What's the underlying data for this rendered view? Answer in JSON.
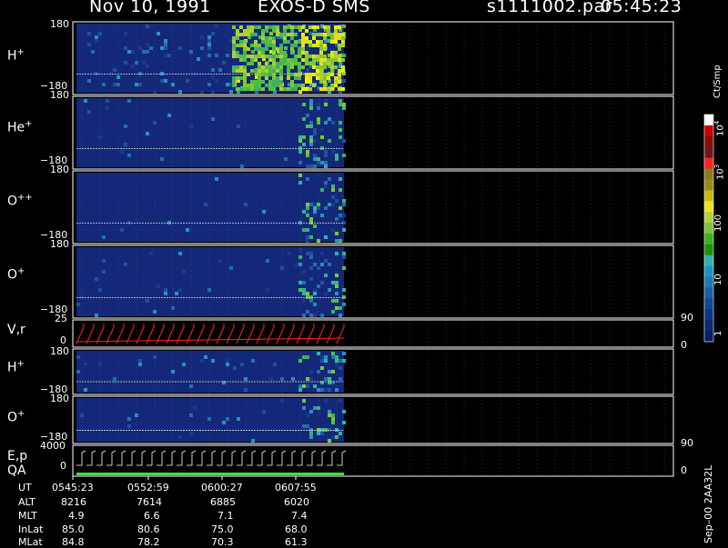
{
  "header": {
    "date": "Nov 10, 1991",
    "instrument": "EXOS-D SMS",
    "file": "s1111002.par",
    "time": "05:45:23"
  },
  "panels": [
    {
      "label_main": "H",
      "label_sup": "+",
      "y_top": "180",
      "y_bot": "−180"
    },
    {
      "label_main": "He",
      "label_sup": "+",
      "y_top": "180",
      "y_bot": "−180"
    },
    {
      "label_main": "O",
      "label_sup": "++",
      "y_top": "180",
      "y_bot": "−180"
    },
    {
      "label_main": "O",
      "label_sup": "+",
      "y_top": "180",
      "y_bot": "−180"
    },
    {
      "label_main": "V,r",
      "label_sup": "",
      "y_top": "25",
      "y_bot": "0",
      "right_top": "90",
      "right_bot": "0"
    },
    {
      "label_main": "H",
      "label_sup": "+",
      "y_top": "180",
      "y_bot": "−180"
    },
    {
      "label_main": "O",
      "label_sup": "+",
      "y_top": "180",
      "y_bot": "−180"
    },
    {
      "label_main": "E,p",
      "label_sup": "",
      "label_main2": "QA",
      "y_top": "4000",
      "y_bot": "0",
      "right_top": "90",
      "right_bot": "0"
    }
  ],
  "colorbar": {
    "title": "Ct/Smp",
    "labels": [
      "10^4",
      "10^3",
      "100",
      "10",
      "1"
    ],
    "colors": [
      "#ffffff",
      "#cc0000",
      "#8a0a0a",
      "#6b1a1a",
      "#ff2020",
      "#8a7a1a",
      "#9a8a18",
      "#c8b818",
      "#f0e020",
      "#b0d040",
      "#80c040",
      "#40b020",
      "#209010",
      "#30b0b0",
      "#2090c0",
      "#207ab0",
      "#1860a0",
      "#144890",
      "#103580",
      "#0c2a70",
      "#081e60"
    ]
  },
  "footer": {
    "rows": [
      {
        "name": "UT",
        "values": [
          "0545:23",
          "0552:59",
          "0600:27",
          "0607:55"
        ]
      },
      {
        "name": "ALT",
        "values": [
          "8216",
          "7614",
          "6885",
          "6020"
        ]
      },
      {
        "name": "MLT",
        "values": [
          "4.9",
          "6.6",
          "7.1",
          "7.4"
        ]
      },
      {
        "name": "InLat",
        "values": [
          "85.0",
          "80.6",
          "75.0",
          "68.0"
        ]
      },
      {
        "name": "MLat",
        "values": [
          "84.8",
          "78.2",
          "70.3",
          "61.3"
        ]
      }
    ],
    "side_text": "Sep–00  2AA32L"
  },
  "chart_data": {
    "type": "heatmap",
    "title": "Nov 10, 1991   EXOS-D SMS",
    "file": "s1111002.par",
    "start_time": "05:45:23",
    "panels": [
      {
        "species": "H+",
        "ylim": [
          -180,
          180
        ]
      },
      {
        "species": "He+",
        "ylim": [
          -180,
          180
        ]
      },
      {
        "species": "O++",
        "ylim": [
          -180,
          180
        ]
      },
      {
        "species": "O+",
        "ylim": [
          -180,
          180
        ]
      },
      {
        "species": "V,r",
        "ylim": [
          0,
          25
        ],
        "right_ylim": [
          0,
          90
        ]
      },
      {
        "species": "H+",
        "ylim": [
          -180,
          180
        ]
      },
      {
        "species": "O+",
        "ylim": [
          -180,
          180
        ]
      },
      {
        "species": "E,p / QA",
        "ylim": [
          0,
          4000
        ],
        "right_ylim": [
          0,
          90
        ]
      }
    ],
    "colorbar": {
      "label": "Ct/Smp",
      "scale": "log",
      "range": [
        1,
        10000
      ]
    },
    "x_ticks_UT": [
      "0545:23",
      "0552:59",
      "0600:27",
      "0607:55"
    ],
    "orbit_table": {
      "ALT": [
        8216,
        7614,
        6885,
        6020
      ],
      "MLT": [
        4.9,
        6.6,
        7.1,
        7.4
      ],
      "InLat": [
        85.0,
        80.6,
        75.0,
        68.0
      ],
      "MLat": [
        84.8,
        78.2,
        70.3,
        61.3
      ]
    }
  }
}
